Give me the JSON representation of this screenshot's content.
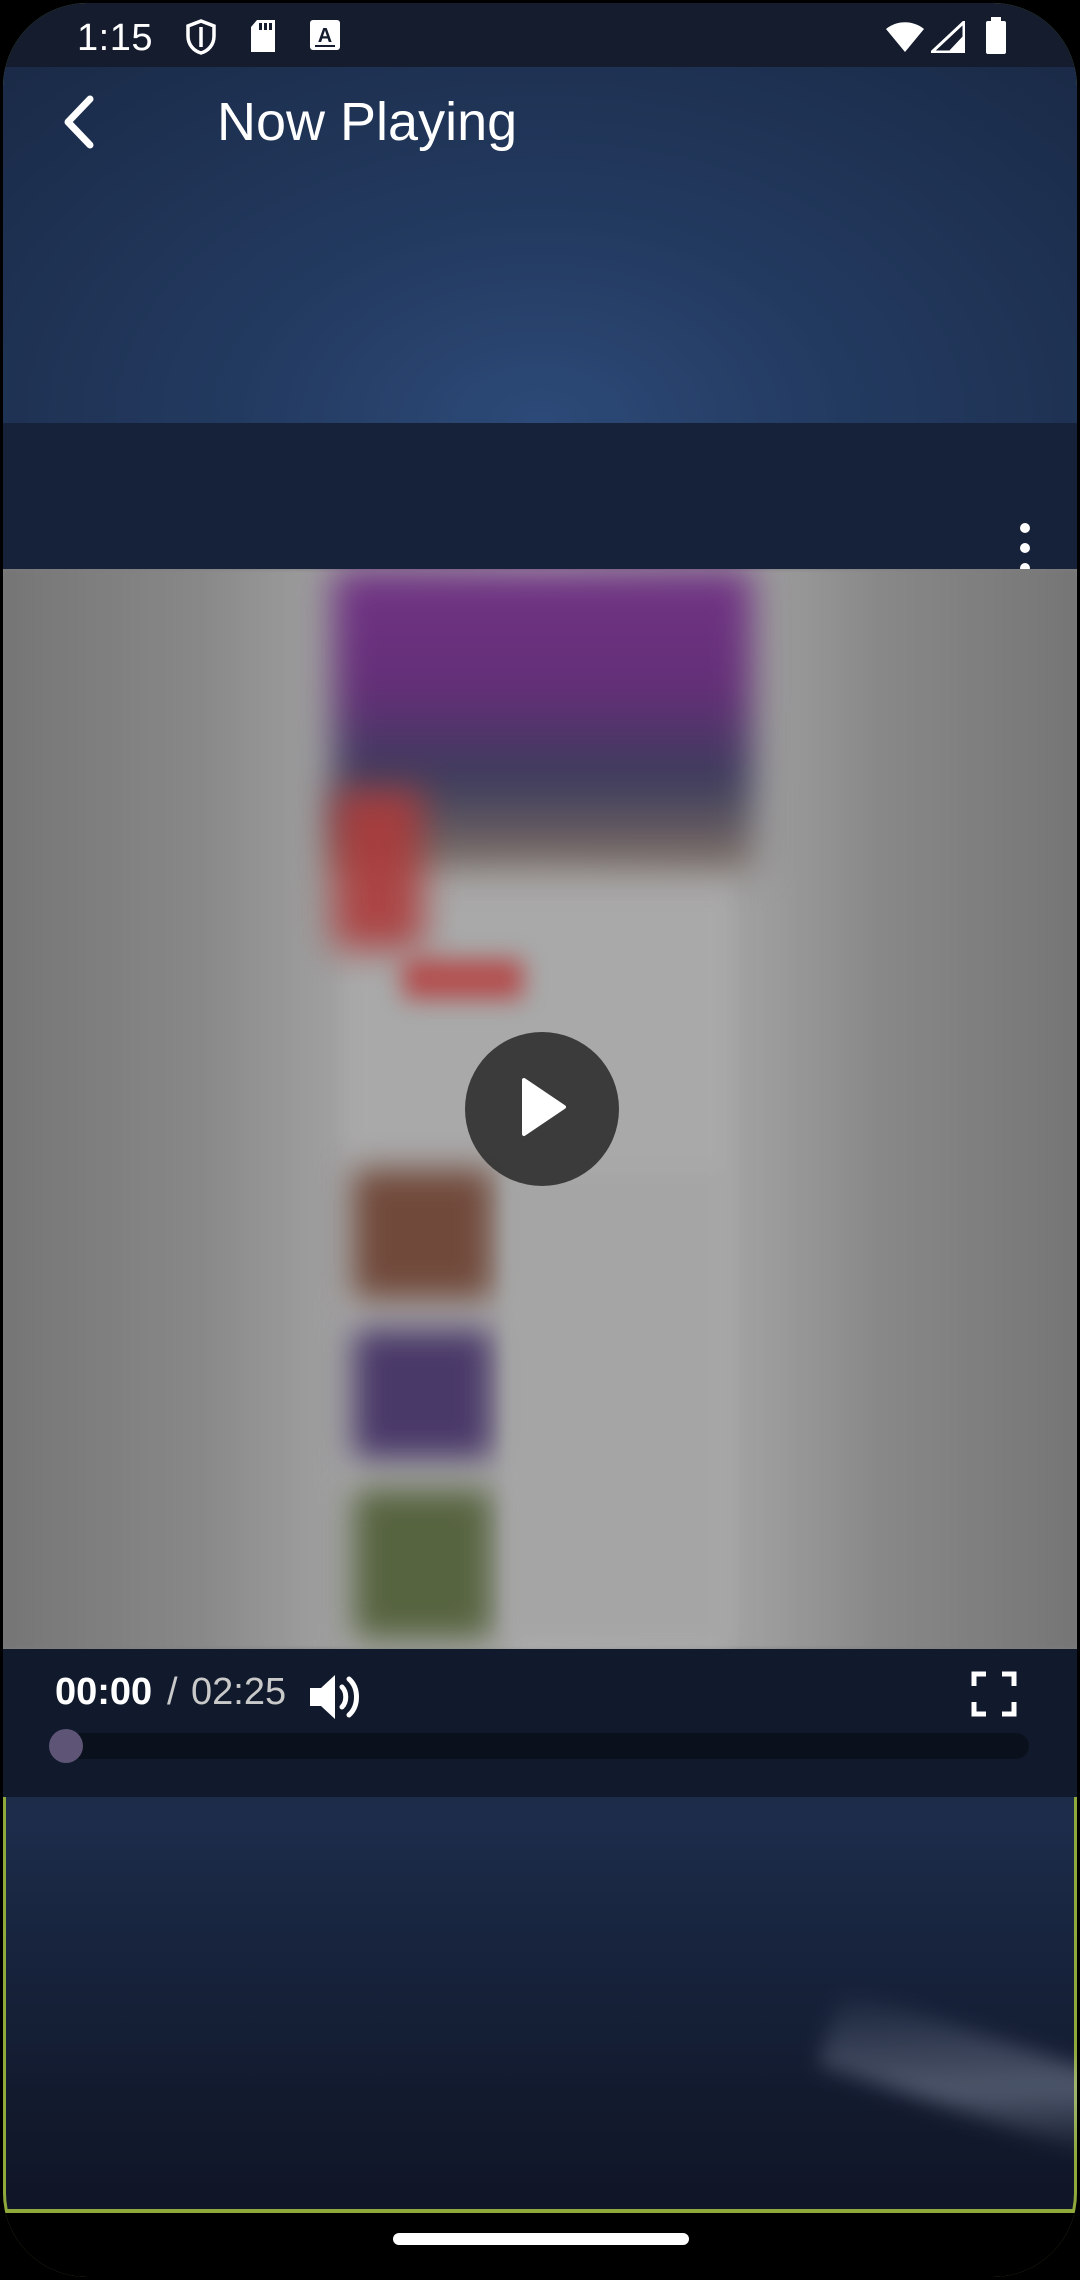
{
  "status_bar": {
    "time": "1:15",
    "icons": [
      "shield-icon",
      "sd-card-icon",
      "keyboard-a-icon",
      "wifi-icon",
      "signal-icon",
      "battery-icon"
    ]
  },
  "app_bar": {
    "title": "Now Playing",
    "back_icon": "chevron-left-icon"
  },
  "player": {
    "more_options_icon": "more-vertical-icon",
    "play_icon": "play-icon",
    "current_time": "00:00",
    "separator": "/",
    "total_time": "02:25",
    "volume_icon": "volume-icon",
    "fullscreen_icon": "fullscreen-icon",
    "progress_fraction": 0.0
  },
  "colors": {
    "accent_green_border": "#8fa93a",
    "progress_thumb": "#5e5576",
    "control_bar": "#111a2c"
  }
}
